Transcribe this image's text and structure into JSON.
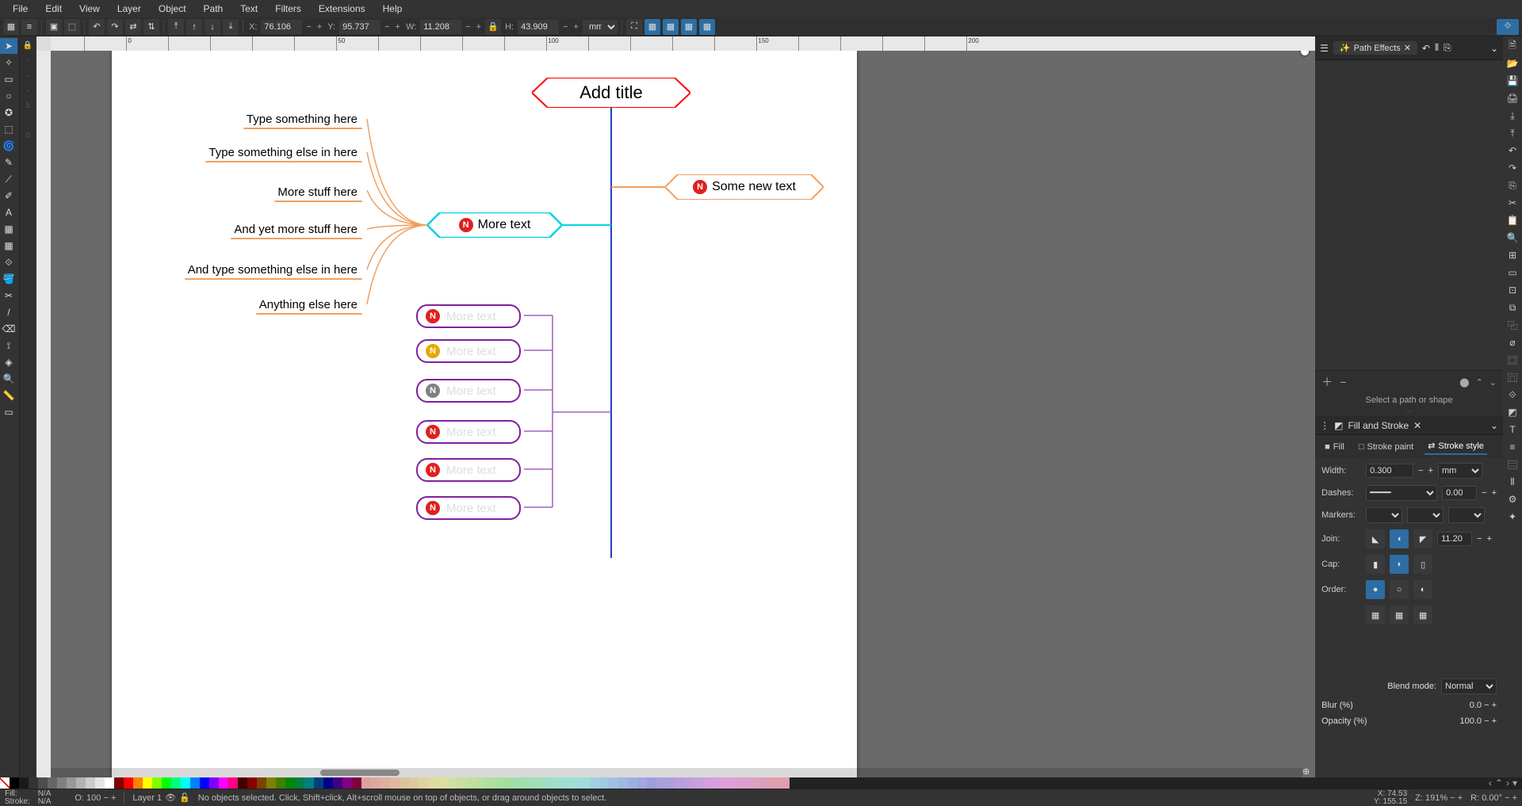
{
  "menu": [
    "File",
    "Edit",
    "View",
    "Layer",
    "Object",
    "Path",
    "Text",
    "Filters",
    "Extensions",
    "Help"
  ],
  "toolbar": {
    "x_label": "X:",
    "x": "76.106",
    "y_label": "Y:",
    "y": "95.737",
    "w_label": "W:",
    "w": "11.208",
    "h_label": "H:",
    "h": "43.909",
    "units": "mm"
  },
  "dock": {
    "path_effects": {
      "title": "Path Effects",
      "hint": "Select a path or shape"
    },
    "fill_stroke": {
      "title": "Fill and Stroke",
      "tabs": {
        "fill": "Fill",
        "stroke_paint": "Stroke paint",
        "stroke_style": "Stroke style"
      },
      "width_label": "Width:",
      "width": "0.300",
      "width_unit": "mm",
      "dashes_label": "Dashes:",
      "dash_offset": "0.00",
      "markers_label": "Markers:",
      "join_label": "Join:",
      "join_val": "11.20",
      "cap_label": "Cap:",
      "order_label": "Order:",
      "blend_label": "Blend mode:",
      "blend": "Normal",
      "blur_label": "Blur (%)",
      "blur": "0.0",
      "opacity_label": "Opacity (%)",
      "opacity": "100.0"
    }
  },
  "canvas": {
    "title": "Add title",
    "left_items": [
      "Type something here",
      "Type something else in here",
      "More stuff here",
      "And yet more stuff here",
      "And type something else in here",
      "Anything else here"
    ],
    "cyan_node": "More text",
    "orange_node": "Some new text",
    "purple_nodes": [
      "More text",
      "More text",
      "More text",
      "More text",
      "More text",
      "More text"
    ],
    "purple_badge_colors": [
      "#e02020",
      "#e8a800",
      "#808080",
      "#e02020",
      "#e02020",
      "#e02020"
    ]
  },
  "status": {
    "fill_label": "Fill:",
    "fill": "N/A",
    "stroke_label": "Stroke:",
    "stroke": "N/A",
    "o_label": "O:",
    "o": "100",
    "layer": "Layer 1",
    "msg": "No objects selected. Click, Shift+click, Alt+scroll mouse on top of objects, or drag around objects to select.",
    "x_label": "X:",
    "x": "74.53",
    "y_label": "Y:",
    "y": "155.15",
    "z_label": "Z:",
    "z": "191%",
    "r_label": "R:",
    "r": "0.00°"
  },
  "tools": [
    "➤",
    "✦",
    "▭",
    "○",
    "✪",
    "⬒",
    "🌀",
    "✎",
    "⟋",
    "✐",
    "〰",
    "A",
    "▦",
    "▢",
    "🪣",
    "⟐",
    "✂",
    "/",
    "🔍",
    "📏",
    "📄",
    "▭",
    "📐"
  ]
}
